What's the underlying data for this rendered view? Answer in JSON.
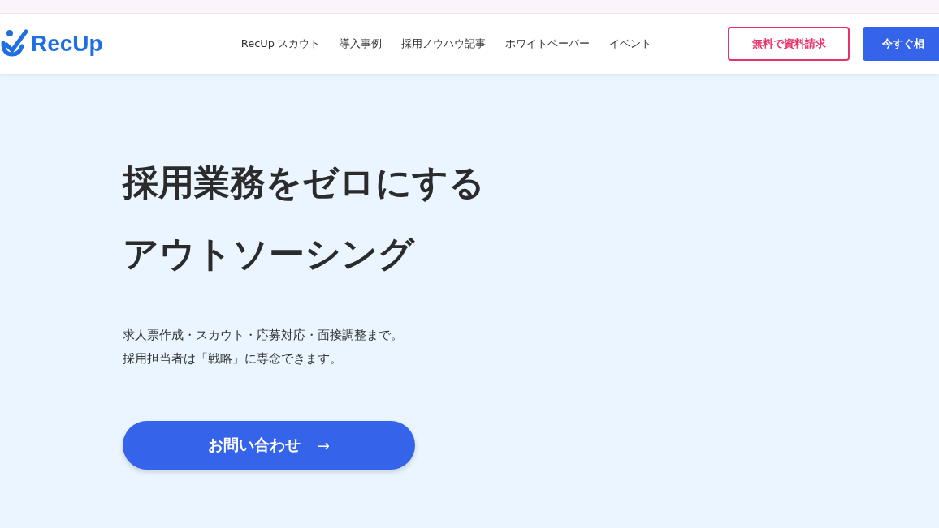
{
  "header": {
    "logo": "RecUp",
    "nav": [
      "RecUp スカウト",
      "導入事例",
      "採用ノウハウ記事",
      "ホワイトペーパー",
      "イベント"
    ],
    "buttons": [
      {
        "label": "無料で資料請求",
        "kind": "outline"
      },
      {
        "label": "今すぐ相",
        "kind": "solid"
      }
    ]
  },
  "hero": {
    "title_lines": [
      "採用業務をゼロにする",
      "アウトソーシング"
    ],
    "description_lines": [
      "求人票作成・スカウト・応募対応・面接調整まで。",
      "採用担当者は「戦略」に専念できます。"
    ],
    "cta": {
      "label": "お問い合わせ",
      "arrow": "→"
    }
  }
}
